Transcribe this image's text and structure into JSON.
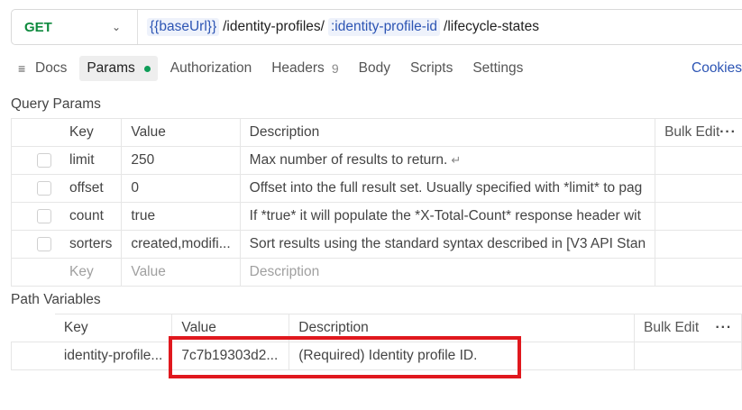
{
  "request": {
    "method": "GET",
    "url_parts": [
      {
        "text": "{{baseUrl}}",
        "kind": "var"
      },
      {
        "text": "/identity-profiles/",
        "kind": "plain"
      },
      {
        "text": ":identity-profile-id",
        "kind": "path"
      },
      {
        "text": "/lifecycle-states",
        "kind": "plain"
      }
    ]
  },
  "tabs": {
    "docs": "Docs",
    "params": "Params",
    "authorization": "Authorization",
    "headers": "Headers",
    "headers_count": "9",
    "body": "Body",
    "scripts": "Scripts",
    "settings": "Settings",
    "cookies": "Cookies"
  },
  "query_params": {
    "title": "Query Params",
    "headers": {
      "key": "Key",
      "value": "Value",
      "description": "Description",
      "bulk_edit": "Bulk Edit"
    },
    "rows": [
      {
        "key": "limit",
        "value": "250",
        "description": "Max number of results to return."
      },
      {
        "key": "offset",
        "value": "0",
        "description": "Offset into the full result set. Usually specified with *limit* to pag"
      },
      {
        "key": "count",
        "value": "true",
        "description": "If *true* it will populate the *X-Total-Count* response header wit"
      },
      {
        "key": "sorters",
        "value": "created,modifi...",
        "description": "Sort results using the standard syntax described in [V3 API Stan"
      }
    ],
    "placeholder": {
      "key": "Key",
      "value": "Value",
      "description": "Description"
    }
  },
  "path_variables": {
    "title": "Path Variables",
    "headers": {
      "key": "Key",
      "value": "Value",
      "description": "Description",
      "bulk_edit": "Bulk Edit"
    },
    "rows": [
      {
        "key": "identity-profile...",
        "value": "7c7b19303d2...",
        "description": "(Required) Identity profile ID."
      }
    ]
  },
  "colors": {
    "accent": "#2d55b4",
    "method": "#0f8a3e",
    "highlight": "#e0181e",
    "active_dot": "#0f9d58"
  }
}
